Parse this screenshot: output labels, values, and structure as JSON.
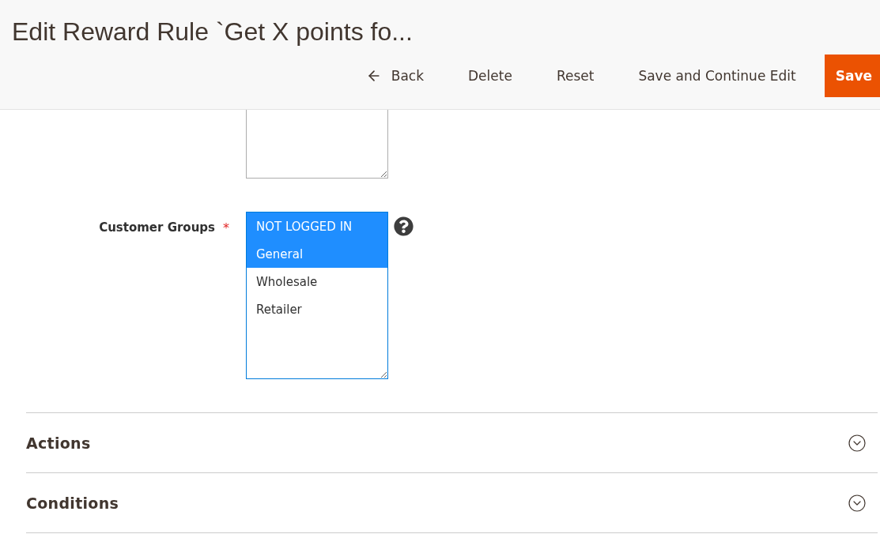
{
  "page_title": "Edit Reward Rule `Get X points fo...",
  "actions": [
    {
      "kind": "back",
      "label": "Back"
    },
    {
      "kind": "plain",
      "label": "Delete"
    },
    {
      "kind": "plain",
      "label": "Reset"
    },
    {
      "kind": "plain",
      "label": "Save and Continue Edit"
    },
    {
      "kind": "primary",
      "label": "Save"
    }
  ],
  "customer_groups": {
    "label": "Customer Groups",
    "required_mark": "*",
    "options": [
      {
        "label": "NOT LOGGED IN",
        "selected": true
      },
      {
        "label": "General",
        "selected": true
      },
      {
        "label": "Wholesale",
        "selected": false
      },
      {
        "label": "Retailer",
        "selected": false
      }
    ]
  },
  "sections": [
    {
      "title": "Actions",
      "expanded": false
    },
    {
      "title": "Conditions",
      "expanded": false
    }
  ]
}
